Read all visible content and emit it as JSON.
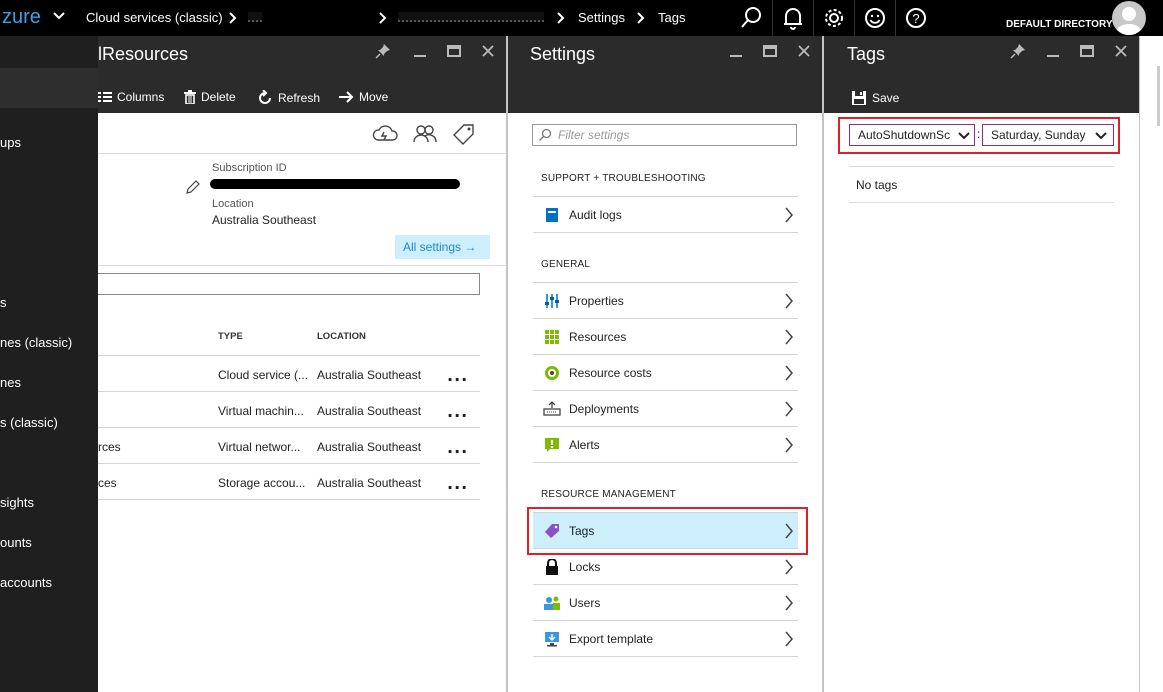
{
  "topbar": {
    "brand": "zure",
    "breadcrumbs": [
      "Cloud services (classic)",
      "Settings",
      "Tags"
    ],
    "directory": "DEFAULT DIRECTORY",
    "icons": [
      "search-icon",
      "bell-icon",
      "gear-icon",
      "smiley-icon",
      "help-icon"
    ]
  },
  "leftnav": {
    "items": [
      "ups",
      "s",
      "nes (classic)",
      "nes",
      "s (classic)",
      "sights",
      "ounts",
      "accounts"
    ]
  },
  "resources_blade": {
    "title": "lResources",
    "commands": [
      "Columns",
      "Delete",
      "Refresh",
      "Move"
    ],
    "subscription_label": "Subscription ID",
    "location_label": "Location",
    "location_value": "Australia Southeast",
    "all_settings": "All settings →",
    "table": {
      "headers": [
        "TYPE",
        "LOCATION"
      ],
      "rows": [
        {
          "name": "",
          "type": "Cloud service (...",
          "location": "Australia Southeast"
        },
        {
          "name": "",
          "type": "Virtual machin...",
          "location": "Australia Southeast"
        },
        {
          "name": "rces",
          "type": "Virtual networ...",
          "location": "Australia Southeast"
        },
        {
          "name": "ces",
          "type": "Storage accou...",
          "location": "Australia Southeast"
        }
      ],
      "more": "..."
    }
  },
  "settings_blade": {
    "title": "Settings",
    "filter_placeholder": "Filter settings",
    "sections": [
      {
        "heading": "SUPPORT + TROUBLESHOOTING",
        "items": [
          "Audit logs"
        ]
      },
      {
        "heading": "GENERAL",
        "items": [
          "Properties",
          "Resources",
          "Resource costs",
          "Deployments",
          "Alerts"
        ]
      },
      {
        "heading": "RESOURCE MANAGEMENT",
        "items": [
          "Tags",
          "Locks",
          "Users",
          "Export template"
        ]
      }
    ]
  },
  "tags_blade": {
    "title": "Tags",
    "save": "Save",
    "key_value": "AutoShutdownSc",
    "colon": ":",
    "value_value": "Saturday, Sunday",
    "empty_text": "No tags"
  },
  "colors": {
    "topbar": "#000000",
    "leftnav": "#1f1f1f",
    "blade_header": "#2b2b2b",
    "accent": "#3aa0e6",
    "selected_item": "#cdeefb",
    "highlight_border": "#d9222a"
  }
}
